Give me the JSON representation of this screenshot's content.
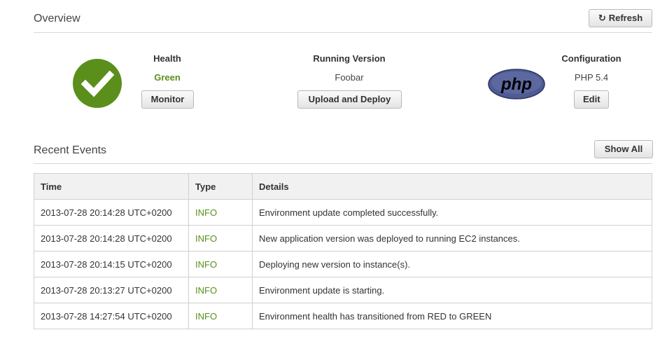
{
  "overview": {
    "title": "Overview",
    "refresh_label": "Refresh"
  },
  "health": {
    "heading": "Health",
    "status": "Green",
    "monitor_label": "Monitor"
  },
  "running_version": {
    "heading": "Running Version",
    "value": "Foobar",
    "deploy_label": "Upload and Deploy"
  },
  "configuration": {
    "heading": "Configuration",
    "value": "PHP 5.4",
    "edit_label": "Edit",
    "logo_text": "php"
  },
  "recent_events": {
    "title": "Recent Events",
    "show_all_label": "Show All",
    "columns": [
      "Time",
      "Type",
      "Details"
    ],
    "rows": [
      {
        "time": "2013-07-28 20:14:28 UTC+0200",
        "type": "INFO",
        "details": "Environment update completed successfully."
      },
      {
        "time": "2013-07-28 20:14:28 UTC+0200",
        "type": "INFO",
        "details": "New application version was deployed to running EC2 instances."
      },
      {
        "time": "2013-07-28 20:14:15 UTC+0200",
        "type": "INFO",
        "details": "Deploying new version to instance(s)."
      },
      {
        "time": "2013-07-28 20:13:27 UTC+0200",
        "type": "INFO",
        "details": "Environment update is starting."
      },
      {
        "time": "2013-07-28 14:27:54 UTC+0200",
        "type": "INFO",
        "details": "Environment health has transitioned from RED to GREEN"
      }
    ]
  },
  "colors": {
    "status_green": "#5a8f1c",
    "php_purple": "#4f5b93"
  }
}
